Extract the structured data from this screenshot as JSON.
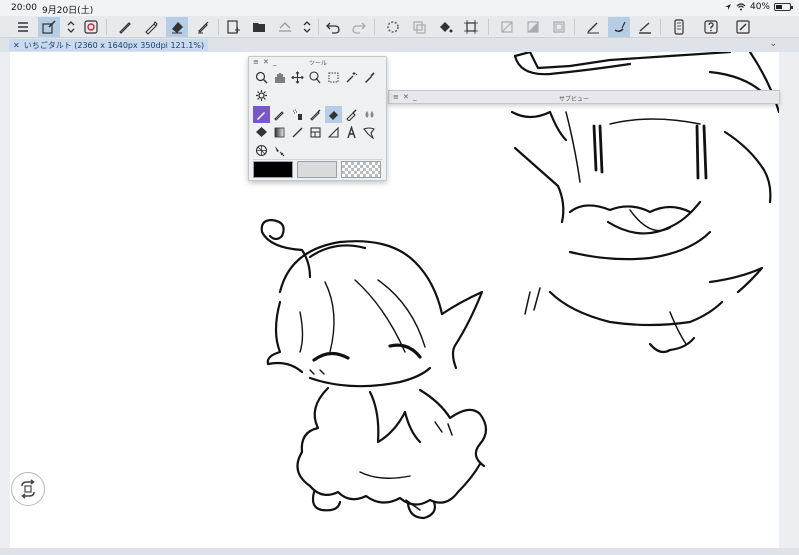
{
  "statusbar": {
    "time": "20:00",
    "date": "9月20日(土)",
    "battery": "40%"
  },
  "toolbar": {
    "icons": [
      "menu-icon",
      "layer-select-icon",
      "updown-arrows-icon",
      "layer-preview-icon",
      "pen-icon",
      "pencil-icon",
      "eraser-icon",
      "marker-icon",
      "new-canvas-icon",
      "open-folder-icon",
      "save-icon",
      "updown-arrows-icon",
      "undo-icon",
      "redo-icon",
      "loading-icon",
      "copy-icon",
      "fill-icon",
      "transform-icon",
      "clear-icon",
      "gray-icon",
      "border-icon",
      "pen-pressure-icon",
      "brush-size-icon",
      "stabilization-icon",
      "phone-icon",
      "help-icon",
      "edit-icon"
    ],
    "active_tools": [
      "layer-select-icon",
      "eraser-icon",
      "brush-size-icon"
    ]
  },
  "document": {
    "tab_title": "いちごタルト (2360 x 1640px 350dpi 121.1%)"
  },
  "tool_panel": {
    "title": "ツール",
    "colors": {
      "main": "#000000",
      "sub": "#d8dadc",
      "transparent": "transparent"
    }
  },
  "sub_view": {
    "title": "サブビュー"
  },
  "colors": {
    "accent": "#b6cde6",
    "tool_highlight": "#7a57c8",
    "canvas": "#ffffff"
  }
}
